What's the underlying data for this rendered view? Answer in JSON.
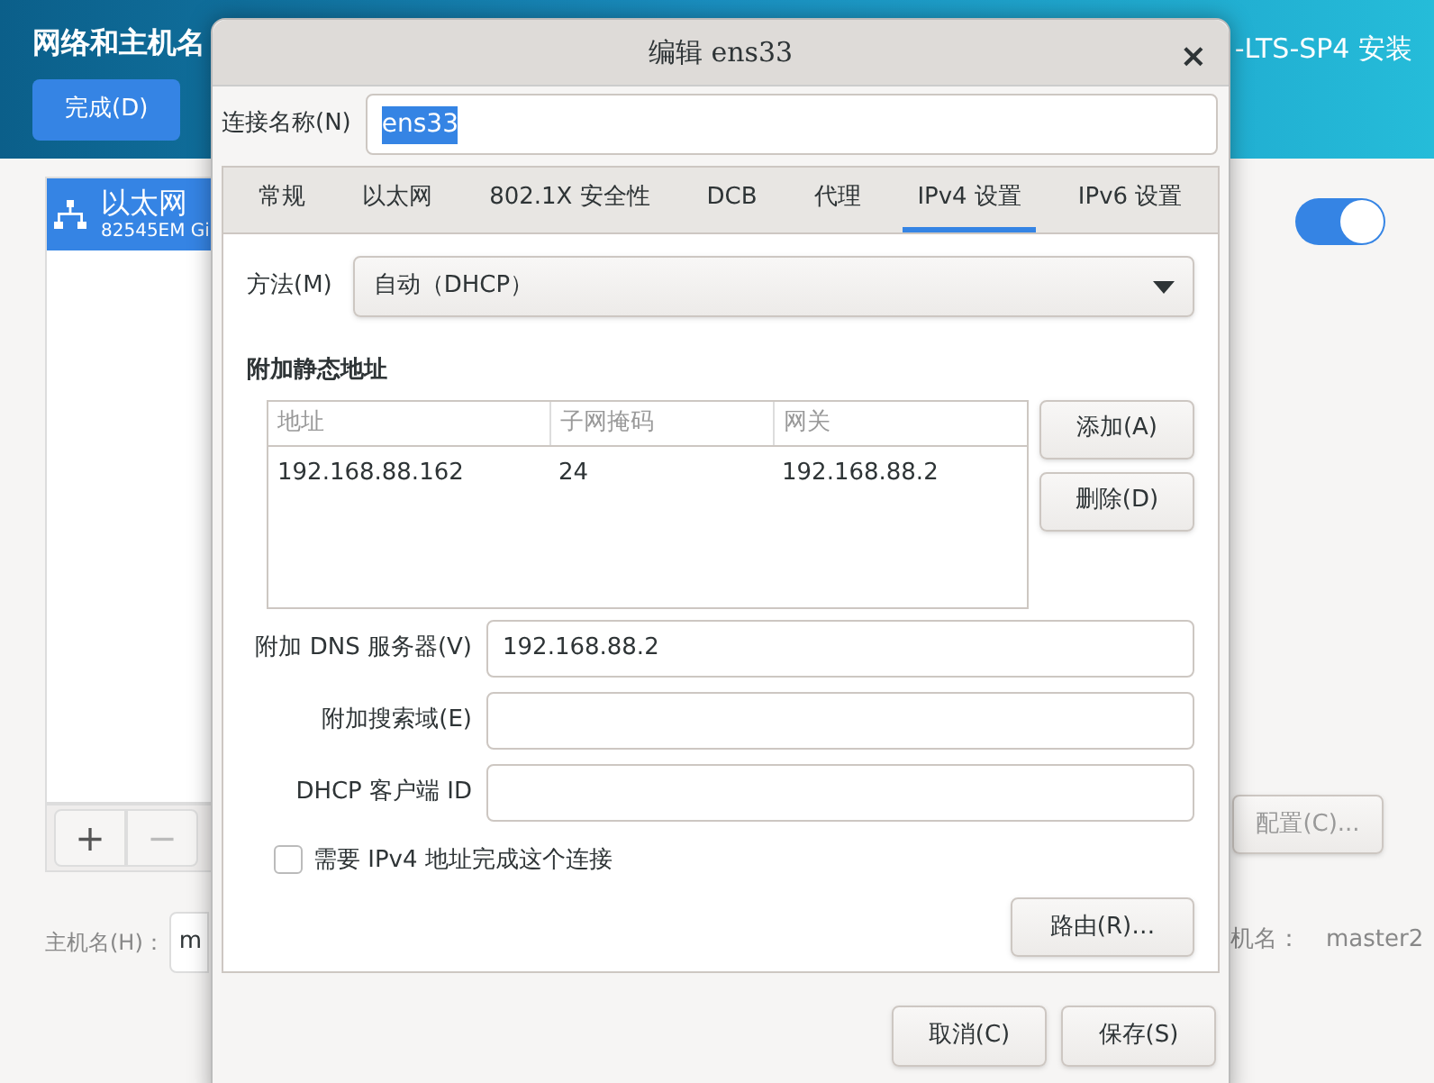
{
  "background": {
    "header_title": "网络和主机名",
    "done_button": "完成(D)",
    "product_title": "-LTS-SP4 安装",
    "network_list": [
      {
        "name": "以太网",
        "detail": "82545EM Gi",
        "selected": true
      }
    ],
    "add_button": "+",
    "remove_button": "−",
    "network_switch": {
      "on": true
    },
    "configure_button": "配置(C)...",
    "hostname_label": "主机名(H)：",
    "hostname_value": "m",
    "current_hostname_label": "机名：",
    "current_hostname": "master2"
  },
  "dialog": {
    "title": "编辑 ens33",
    "close": "×",
    "connection_name_label": "连接名称(N)",
    "connection_name": "ens33",
    "tabs": [
      {
        "label": "常规",
        "selected": false
      },
      {
        "label": "以太网",
        "selected": false
      },
      {
        "label": "802.1X 安全性",
        "selected": false
      },
      {
        "label": "DCB",
        "selected": false
      },
      {
        "label": "代理",
        "selected": false
      },
      {
        "label": "IPv4 设置",
        "selected": true
      },
      {
        "label": "IPv6 设置",
        "selected": false
      }
    ],
    "method_label": "方法(M)",
    "method_value": "自动（DHCP）",
    "static_section_title": "附加静态地址",
    "table": {
      "columns": [
        "地址",
        "子网掩码",
        "网关"
      ],
      "rows": [
        [
          "192.168.88.162",
          "24",
          "192.168.88.2"
        ]
      ]
    },
    "add_button": "添加(A)",
    "delete_button": "删除(D)",
    "fields": [
      {
        "label": "附加 DNS 服务器(V)",
        "value": "192.168.88.2"
      },
      {
        "label": "附加搜索域(E)"
      },
      {
        "label": "DHCP 客户端 ID"
      }
    ],
    "require_ipv4": {
      "label": "需要 IPv4 地址完成这个连接",
      "checked": false
    },
    "routes_button": "路由(R)…",
    "cancel_button": "取消(C)",
    "save_button": "保存(S)"
  }
}
